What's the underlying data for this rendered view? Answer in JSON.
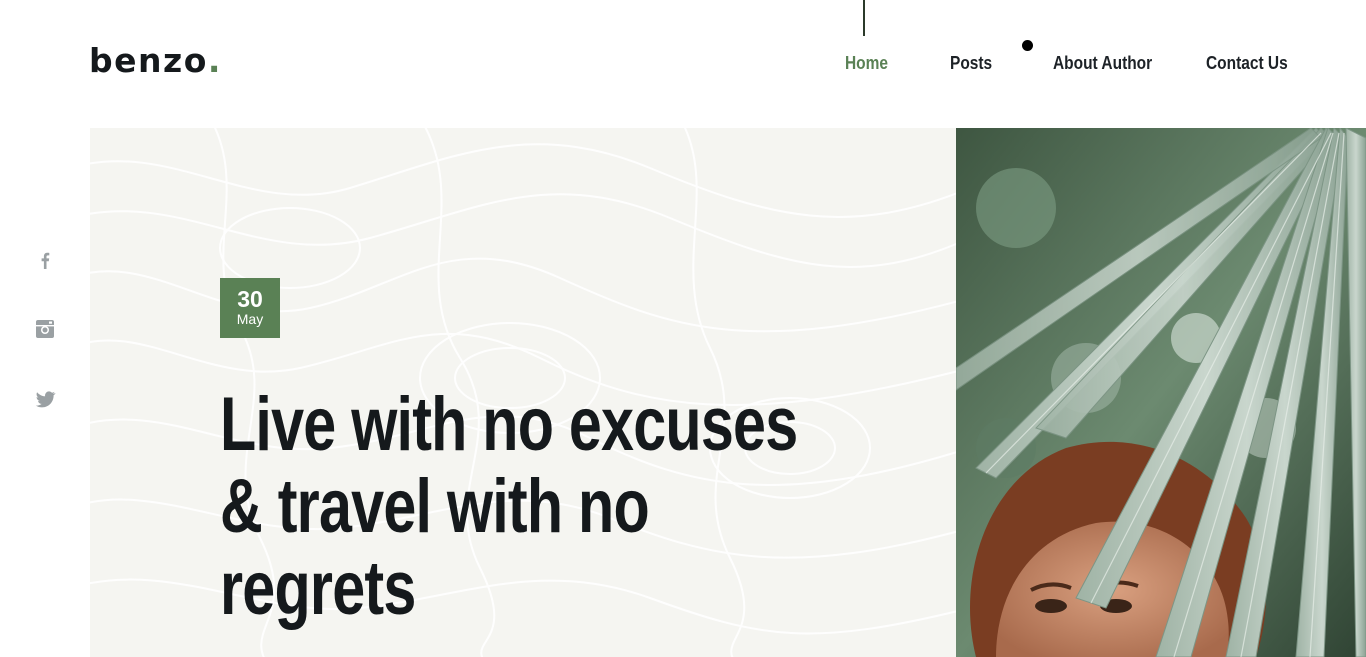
{
  "header": {
    "logo_text": "benzo",
    "logo_dot": "."
  },
  "nav": {
    "items": [
      {
        "label": "Home",
        "active": true
      },
      {
        "label": "Posts",
        "active": false
      },
      {
        "label": "About Author",
        "active": false
      },
      {
        "label": "Contact Us",
        "active": false
      }
    ]
  },
  "social": {
    "items": [
      {
        "icon": "facebook-icon"
      },
      {
        "icon": "instagram-icon"
      },
      {
        "icon": "twitter-icon"
      }
    ]
  },
  "hero": {
    "date_day": "30",
    "date_month": "May",
    "headline_lines": [
      "Live with no excuses",
      "& travel with no",
      "regrets"
    ]
  },
  "colors": {
    "accent": "#5a8155",
    "text_dark": "#15191c",
    "hero_bg": "#f5f5f1"
  }
}
